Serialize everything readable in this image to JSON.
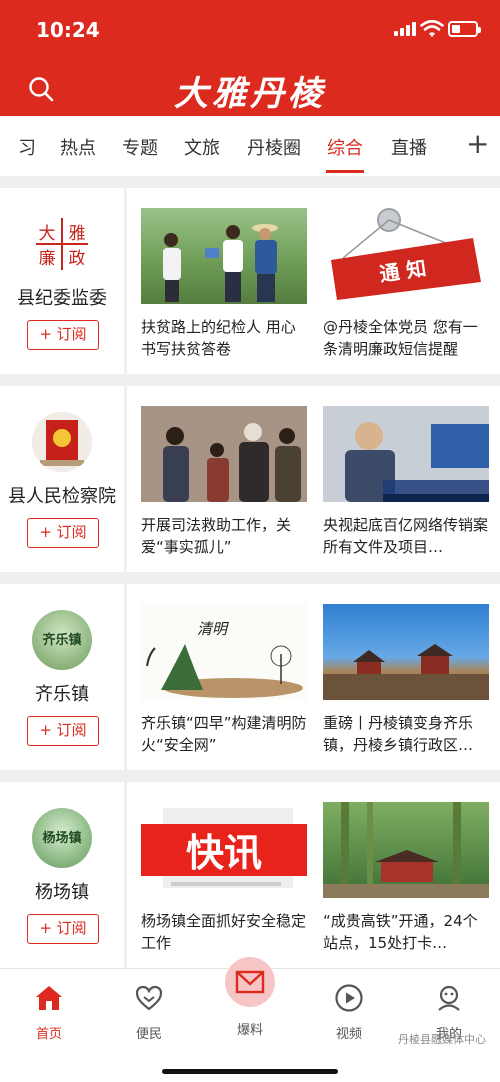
{
  "status": {
    "time": "10:24"
  },
  "header": {
    "logo": "大雅丹棱"
  },
  "tabs": [
    {
      "label": "习"
    },
    {
      "label": "热点"
    },
    {
      "label": "专题"
    },
    {
      "label": "文旅"
    },
    {
      "label": "丹棱圈"
    },
    {
      "label": "综合"
    },
    {
      "label": "直播"
    }
  ],
  "tab_add": "+",
  "cards": [
    {
      "org": "县纪委监委",
      "subscribe": "+ 订阅",
      "news": [
        {
          "title": "扶贫路上的纪检人 用心书写扶贫答卷"
        },
        {
          "title": "@丹棱全体党员 您有一条清明廉政短信提醒"
        }
      ]
    },
    {
      "org": "县人民检察院",
      "subscribe": "+ 订阅",
      "news": [
        {
          "title": "开展司法救助工作，关爱“事实孤儿”"
        },
        {
          "title": "央视起底百亿网络传销案 所有文件及项目…"
        }
      ]
    },
    {
      "org": "齐乐镇",
      "subscribe": "+ 订阅",
      "news": [
        {
          "title": "齐乐镇“四早”构建清明防火“安全网”"
        },
        {
          "title": "重磅丨丹棱镇变身齐乐镇，丹棱乡镇行政区…"
        }
      ]
    },
    {
      "org": "杨场镇",
      "subscribe": "+ 订阅",
      "news": [
        {
          "title": "杨场镇全面抓好安全稳定工作"
        },
        {
          "title": "“成贵高铁”开通，24个站点，15处打卡…"
        }
      ]
    }
  ],
  "thumb_text": {
    "notice": "通 知",
    "kuaixun": "快讯",
    "qingming": "清明"
  },
  "avatar_text": {
    "lian_tl": "大",
    "lian_tr": "雅",
    "lian_bl": "廉",
    "lian_br": "政",
    "qile": "齐乐镇",
    "yangchang": "杨场镇"
  },
  "bottom_nav": {
    "home": "首页",
    "bianmin": "便民",
    "baoliao": "爆料",
    "video": "视频",
    "mine": "我的"
  },
  "watermark": "丹棱县融媒体中心",
  "colors": {
    "brand": "#dc2a1f"
  }
}
